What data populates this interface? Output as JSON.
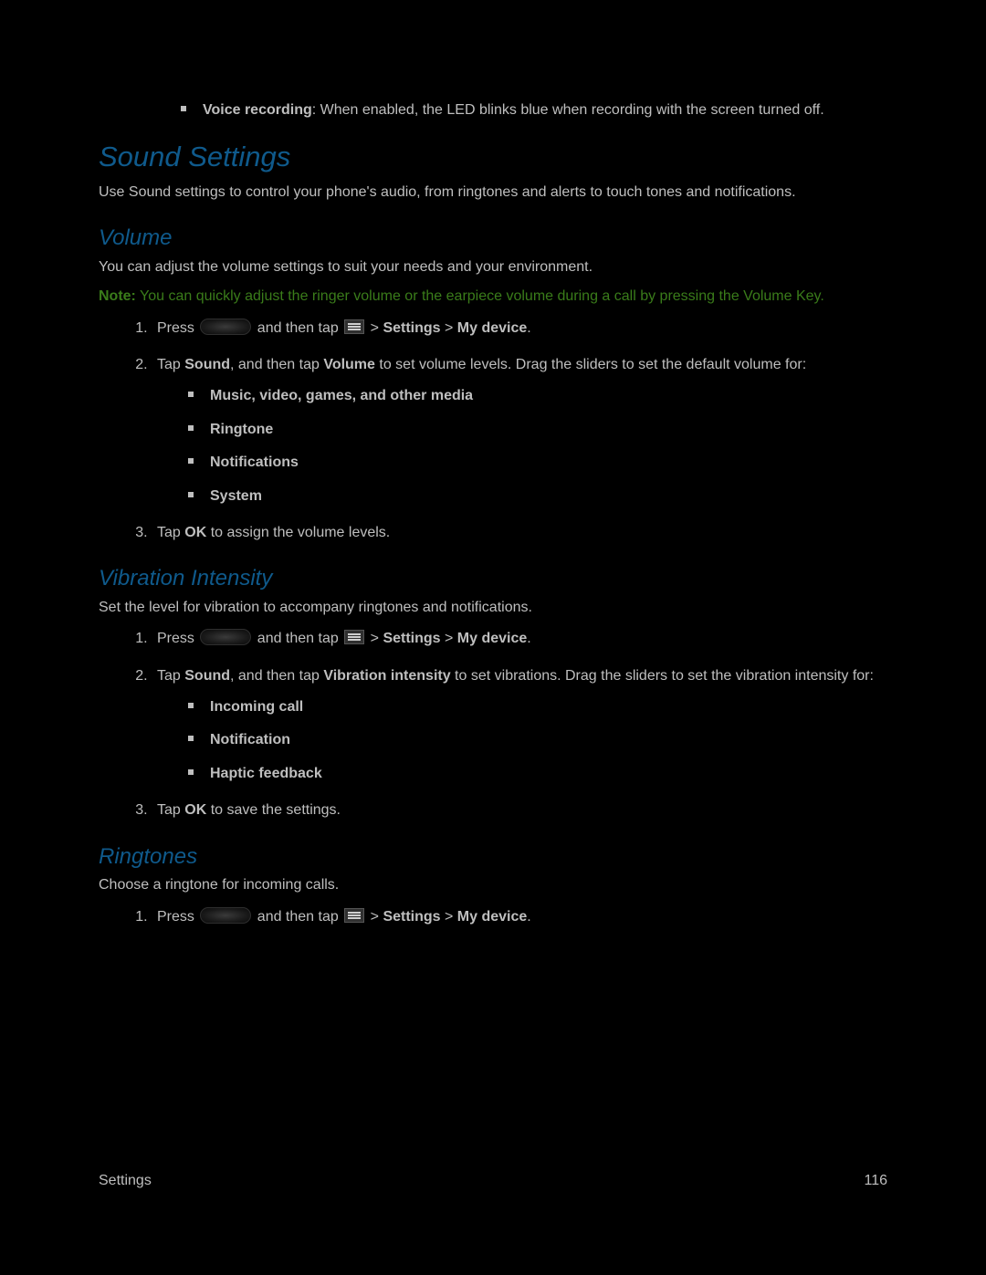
{
  "top": {
    "voice_recording_label": "Voice recording",
    "voice_recording_text": ": When enabled, the LED blinks blue when recording with the screen turned off."
  },
  "h1_sound_settings": "Sound Settings",
  "sound_intro": "Use Sound settings to control your phone's audio, from ringtones and alerts to touch tones and notifications.",
  "h2_volume": "Volume",
  "volume_intro": "You can adjust the volume settings to suit your needs and your environment.",
  "volume_note_label": "Note:",
  "volume_note": " You can quickly adjust the ringer volume or the earpiece volume during a call by pressing the Volume Key.",
  "press_text": "Press ",
  "and_then_tap": " and then tap ",
  "gt": " > ",
  "settings_label": "Settings",
  "my_device_label": "My device",
  "period": ".",
  "volume_step2_a": "Tap ",
  "volume_step2_sound": "Sound",
  "volume_step2_b": ", and then tap ",
  "volume_step2_volume": "Volume",
  "volume_step2_c": " to set volume levels. Drag the sliders to set the default volume for:",
  "volume_bullets": {
    "b1": "Music, video, games, and other media",
    "b2": "Ringtone",
    "b3": "Notifications",
    "b4": "System"
  },
  "volume_step3_a": "Tap ",
  "volume_step3_ok": "OK",
  "volume_step3_b": " to assign the volume levels.",
  "h2_vibration": "Vibration Intensity",
  "vibration_intro": "Set the level for vibration to accompany ringtones and notifications.",
  "vibration_step2_a": "Tap ",
  "vibration_step2_sound": "Sound",
  "vibration_step2_b": ", and then tap ",
  "vibration_step2_vi": "Vibration intensity",
  "vibration_step2_c": " to set vibrations. Drag the sliders to set the vibration intensity for:",
  "vibration_bullets": {
    "b1": "Incoming call",
    "b2": "Notification",
    "b3": "Haptic feedback"
  },
  "vibration_step3_a": "Tap ",
  "vibration_step3_ok": "OK",
  "vibration_step3_b": " to save the settings.",
  "h2_ringtones": "Ringtones",
  "ringtones_intro": "Choose a ringtone for incoming calls.",
  "footer_left": "Settings",
  "footer_right": "116"
}
